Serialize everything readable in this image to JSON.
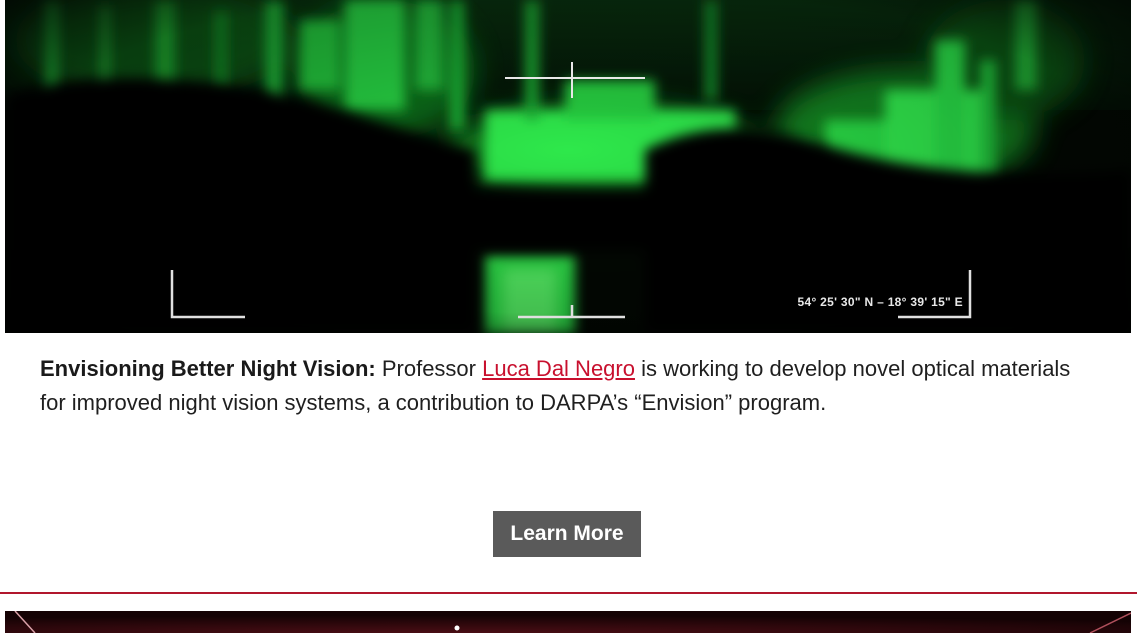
{
  "hero": {
    "coords_text": "54° 25' 30\" N  –  18° 39' 15\" E"
  },
  "caption": {
    "title": "Envisioning Better Night Vision:",
    "text_before_link": " Professor ",
    "link_text": "Luca Dal Negro",
    "text_after_link": " is working to develop novel optical materials for improved night vision systems, a contribution to DARPA’s “Envision” program."
  },
  "button": {
    "label": "Learn More"
  },
  "colors": {
    "link": "#c8102e",
    "button_bg": "#5a5a5a",
    "divider": "#b1172d",
    "night_vision_green": "#33ff33"
  }
}
